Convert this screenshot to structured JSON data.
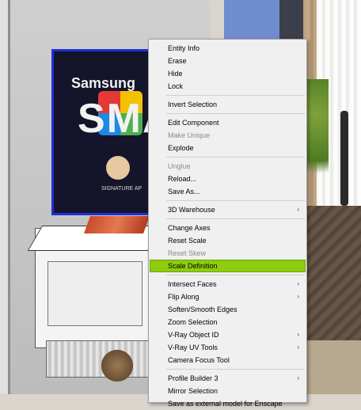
{
  "scene": {
    "tv_brand": "Samsung",
    "tv_logo": "SMAR",
    "tv_caption": "SIGNATURE   AP"
  },
  "context_menu": {
    "highlight_color": "#8dcc0f",
    "groups": [
      [
        {
          "label": "Entity Info",
          "disabled": false,
          "submenu": false
        },
        {
          "label": "Erase",
          "disabled": false,
          "submenu": false
        },
        {
          "label": "Hide",
          "disabled": false,
          "submenu": false
        },
        {
          "label": "Lock",
          "disabled": false,
          "submenu": false
        }
      ],
      [
        {
          "label": "Invert Selection",
          "disabled": false,
          "submenu": false
        }
      ],
      [
        {
          "label": "Edit Component",
          "disabled": false,
          "submenu": false
        },
        {
          "label": "Make Unique",
          "disabled": true,
          "submenu": false
        },
        {
          "label": "Explode",
          "disabled": false,
          "submenu": false
        }
      ],
      [
        {
          "label": "Unglue",
          "disabled": true,
          "submenu": false
        },
        {
          "label": "Reload...",
          "disabled": false,
          "submenu": false
        },
        {
          "label": "Save As...",
          "disabled": false,
          "submenu": false
        }
      ],
      [
        {
          "label": "3D Warehouse",
          "disabled": false,
          "submenu": true
        }
      ],
      [
        {
          "label": "Change Axes",
          "disabled": false,
          "submenu": false
        },
        {
          "label": "Reset Scale",
          "disabled": false,
          "submenu": false
        },
        {
          "label": "Reset Skew",
          "disabled": true,
          "submenu": false
        },
        {
          "label": "Scale Definition",
          "disabled": false,
          "submenu": false,
          "highlighted": true
        }
      ],
      [
        {
          "label": "Intersect Faces",
          "disabled": false,
          "submenu": true
        },
        {
          "label": "Flip Along",
          "disabled": false,
          "submenu": true
        },
        {
          "label": "Soften/Smooth Edges",
          "disabled": false,
          "submenu": false
        },
        {
          "label": "Zoom Selection",
          "disabled": false,
          "submenu": false
        },
        {
          "label": "V-Ray Object ID",
          "disabled": false,
          "submenu": true
        },
        {
          "label": "V-Ray UV Tools",
          "disabled": false,
          "submenu": true
        },
        {
          "label": "Camera Focus Tool",
          "disabled": false,
          "submenu": false
        }
      ],
      [
        {
          "label": "Profile Builder 3",
          "disabled": false,
          "submenu": true
        },
        {
          "label": "Mirror Selection",
          "disabled": false,
          "submenu": false
        },
        {
          "label": "Save as external model for Enscape",
          "disabled": false,
          "submenu": false
        }
      ]
    ],
    "submenu_arrow": "›"
  }
}
